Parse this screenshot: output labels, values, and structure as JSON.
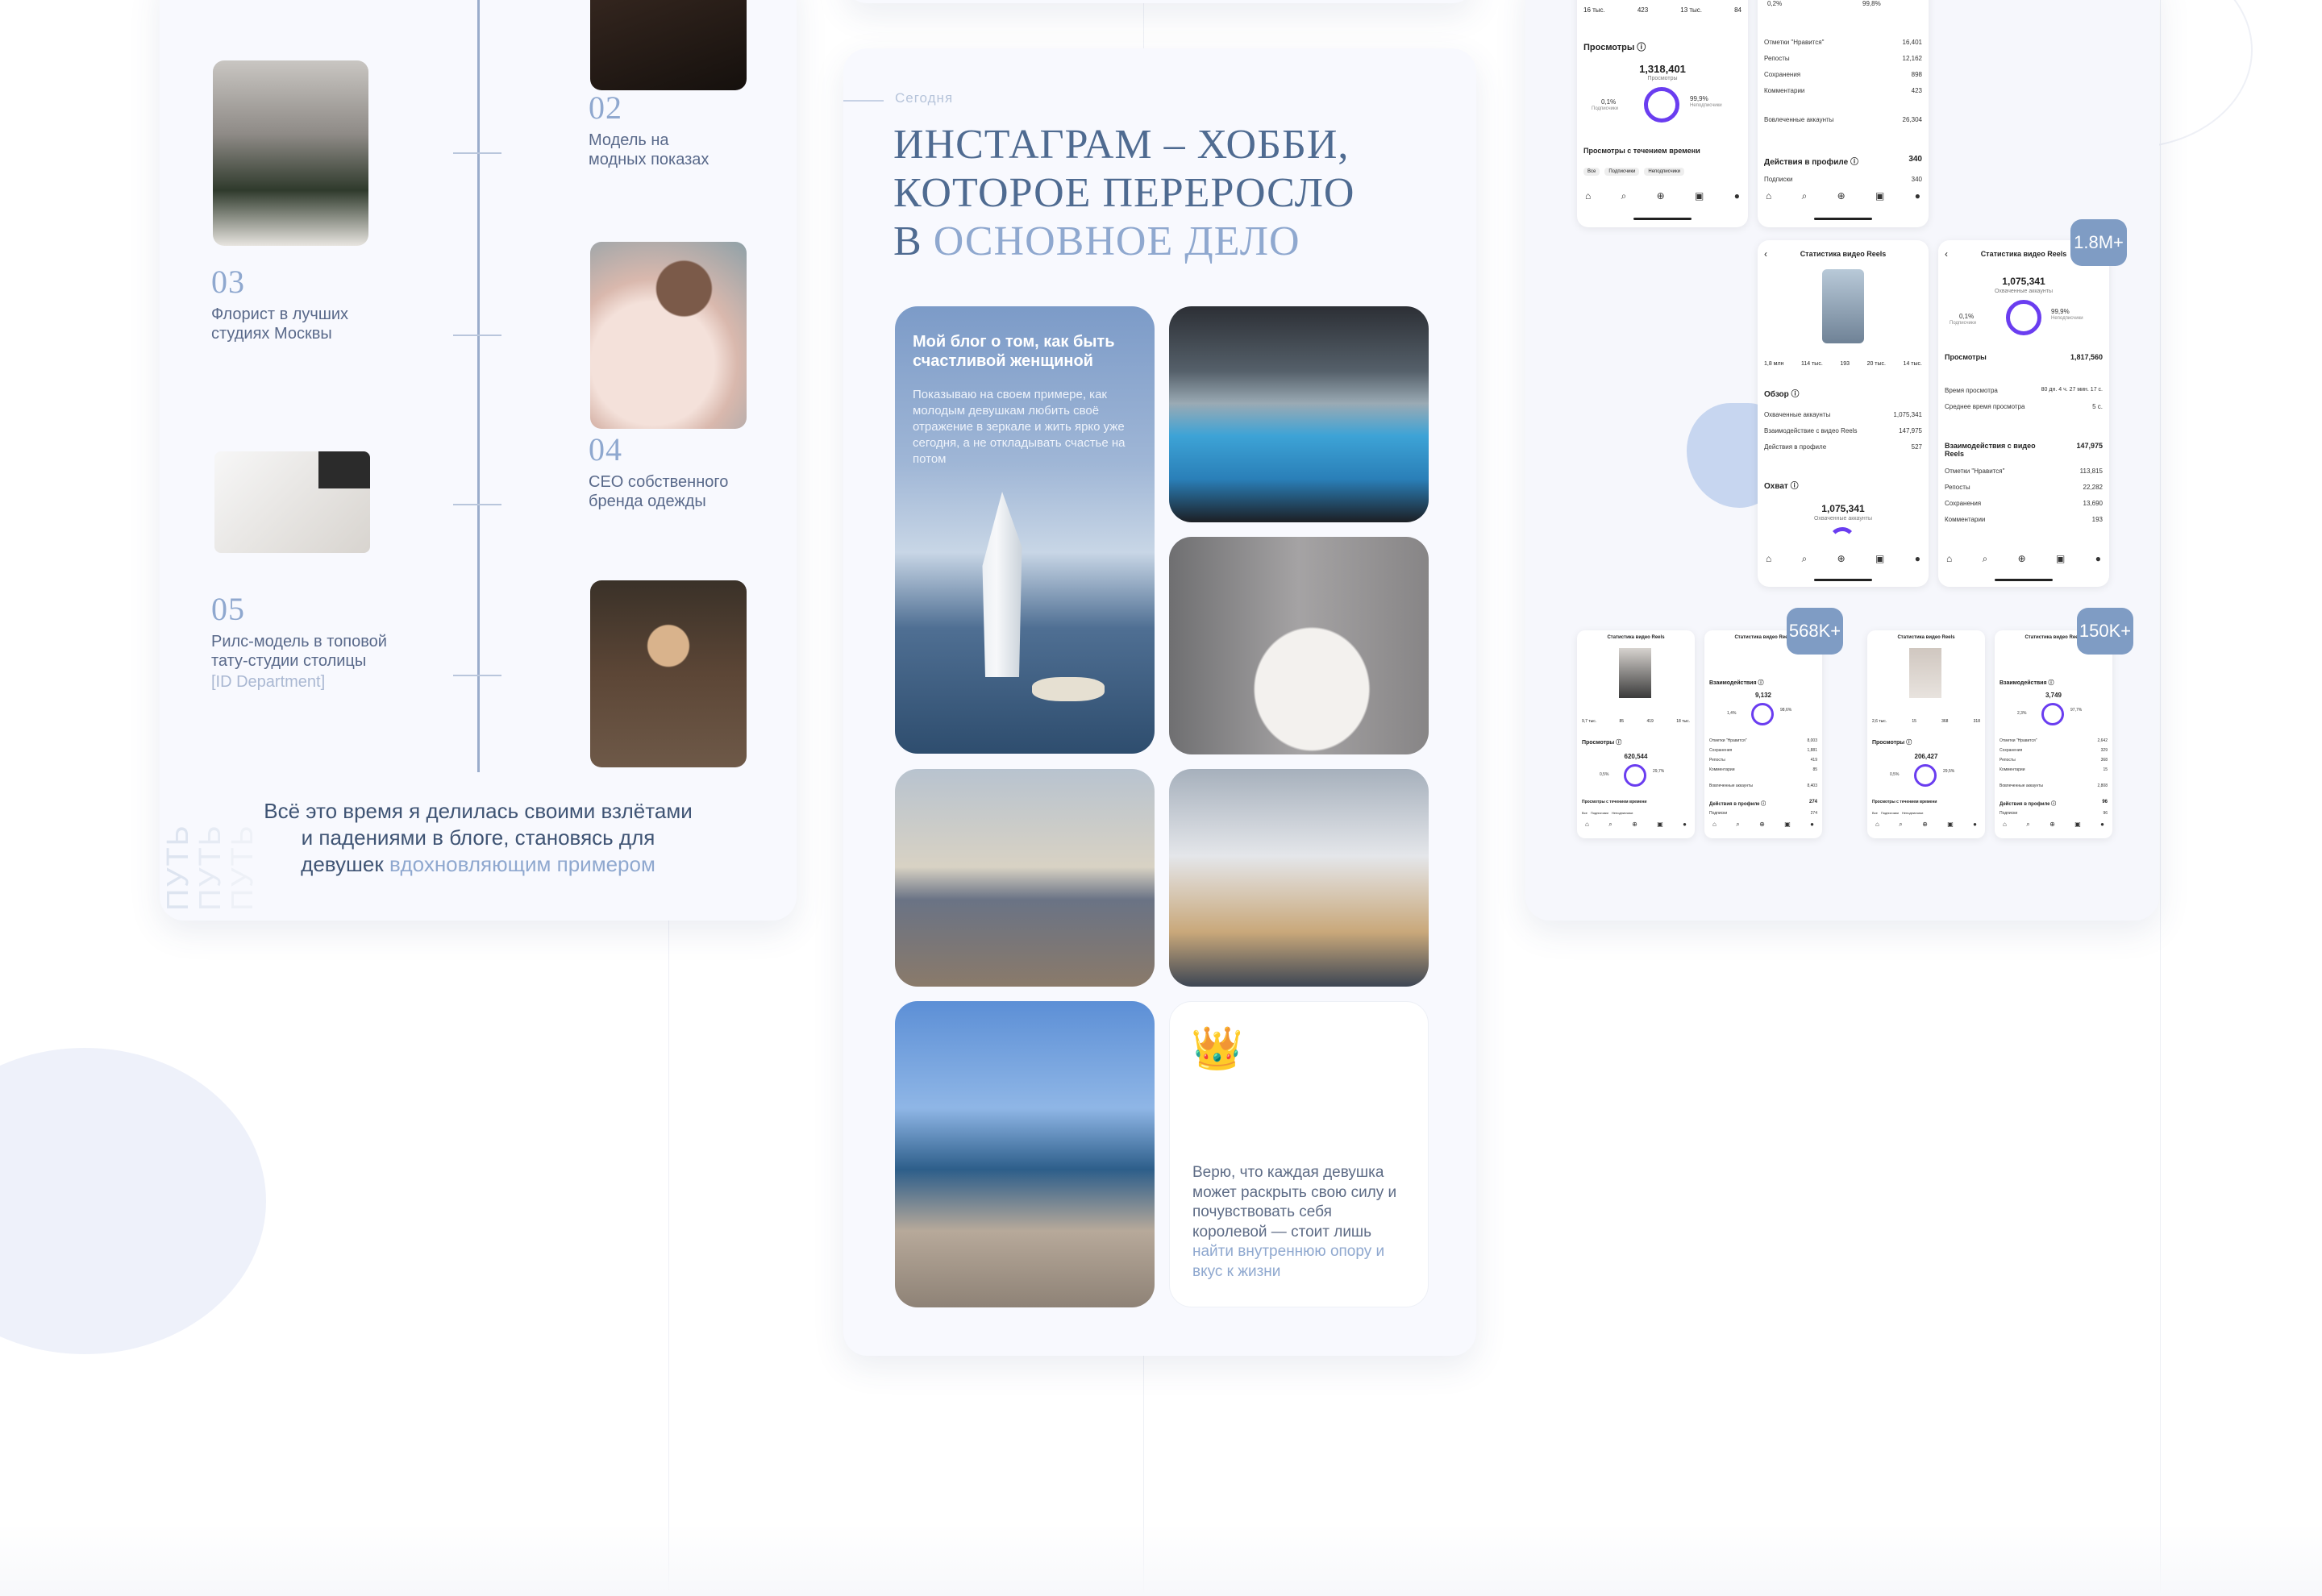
{
  "colors": {
    "accent": "#8fa8cf",
    "title": "#4f6b91",
    "ring": "#6a3df0",
    "badge": "#7f9cc4"
  },
  "timeline": {
    "items": [
      {
        "num": "02",
        "caption": "Модель на\nмодных  показах"
      },
      {
        "num": "03",
        "caption": "Флорист в лучших\nстудиях Москвы"
      },
      {
        "num": "04",
        "caption": "CEO собственного\nбренда одежды"
      },
      {
        "num": "05",
        "caption": "Рилс-модель в топовой\nтату-студии столицы",
        "note": "[ID Department]"
      }
    ],
    "summary": {
      "line1": "Всё это время я делилась своими взлётами",
      "line2": "и падениями в блоге, становясь для",
      "line3": "девушек ",
      "highlight": "вдохновляющим примером"
    },
    "vertical_word": "ПУТЬ"
  },
  "mid": {
    "label": "Сегодня",
    "title_line1": "ИНСТАГРАМ – ХОББИ,",
    "title_line2": "КОТОРОЕ ПЕРЕРОСЛО",
    "title_line3a": "В ",
    "title_line3b": "ОСНОВНОЕ ДЕЛО",
    "blog_title": "Мой блог о том, как быть счастливой женщиной",
    "blog_text": "Показываю на своем примере, как молодым девушкам любить своё отражение в зеркале и жить ярко уже сегодня, а не откладывать счастье на потом",
    "crown": "👑",
    "belief": "Верю, что каждая девушка может раскрыть свою силу и почувствовать себя королевой — стоит лишь ",
    "belief_highlight": "найти внутреннюю опору и вкус к жизни"
  },
  "stats": {
    "top_left": {
      "row": [
        "16 тыс.",
        "423",
        "13 тыс.",
        "84"
      ],
      "views_label": "Просмотры ⓘ",
      "views": "1,318,401",
      "views_sub": "Просмотры",
      "left_pct": "0,1%",
      "left_lbl": "Подписчики",
      "right_pct": "99,9%",
      "right_lbl": "Неподписчики",
      "time_label": "Просмотры с течением времени",
      "chips": [
        "Все",
        "Подписчики",
        "Неподписчики"
      ]
    },
    "top_right": {
      "pct1": "0,2%",
      "pct2": "99,8%",
      "rows": [
        [
          "Отметки \"Нравится\"",
          "16,401"
        ],
        [
          "Репосты",
          "12,162"
        ],
        [
          "Сохранения",
          "898"
        ],
        [
          "Комментарии",
          "423"
        ],
        [
          "Вовлеченные аккаунты",
          "26,304"
        ]
      ],
      "actions_label": "Действия в профиле ⓘ",
      "actions_val": "340",
      "subs_label": "Подписки",
      "subs_val": "340"
    },
    "reels_a": {
      "title": "Статистика видео Reels",
      "row": [
        "1,8 млн",
        "114 тыс.",
        "193",
        "20 тыс.",
        "14 тыс."
      ],
      "overview": "Обзор ⓘ",
      "rows": [
        [
          "Охваченные аккаунты",
          "1,075,341"
        ],
        [
          "Взаимодействие с видео Reels",
          "147,975"
        ],
        [
          "Действия в профиле",
          "527"
        ]
      ],
      "reach_label": "Охват ⓘ",
      "reach": "1,075,341",
      "reach_sub": "Охваченные аккаунты"
    },
    "reels_b": {
      "title": "Статистика видео Reels",
      "reach": "1,075,341",
      "reach_sub": "Охваченные аккаунты",
      "left_pct": "0,1%",
      "left_lbl": "Подписчики",
      "right_pct": "99,9%",
      "right_lbl": "Неподписчики",
      "views_label": "Просмотры",
      "views": "1,817,560",
      "rows1": [
        [
          "Время просмотра",
          "80 дн. 4 ч. 27 мин. 17 с."
        ],
        [
          "Среднее время просмотра",
          "5 с."
        ]
      ],
      "inter_label": "Взаимодействия с видео Reels",
      "inter_val": "147,975",
      "rows2": [
        [
          "Отметки \"Нравится\"",
          "113,815"
        ],
        [
          "Репосты",
          "22,282"
        ],
        [
          "Сохранения",
          "13,690"
        ],
        [
          "Комментарии",
          "193"
        ]
      ]
    },
    "badges": [
      "1.8M+",
      "568K+",
      "150K+"
    ],
    "small_a": {
      "title": "Статистика видео Reels",
      "row": [
        "9,7 тыс.",
        "85",
        "419",
        "18 тыс."
      ],
      "views_label": "Просмотры ⓘ",
      "views": "620,544",
      "l": "0,5%",
      "r": "29,7%",
      "time_label": "Просмотры с течением времени",
      "chips": [
        "Все",
        "Подписчики",
        "Неподписчики"
      ]
    },
    "small_b": {
      "title": "Статистика видео Reels",
      "inter_label": "Взаимодействия ⓘ",
      "inter": "9,132",
      "l": "1,4%",
      "r": "98,6%",
      "rows": [
        [
          "Отметки \"Нравится\"",
          "8,003"
        ],
        [
          "Сохранения",
          "1,881"
        ],
        [
          "Репосты",
          "419"
        ],
        [
          "Комментарии",
          "85"
        ],
        [
          "Вовлеченные аккаунты",
          "8,403"
        ]
      ],
      "actions_label": "Действия в профиле ⓘ",
      "actions_val": "274",
      "subs_label": "Подписки",
      "subs_val": "274"
    },
    "small_c": {
      "title": "Статистика видео Reels",
      "row": [
        "2,6 тыс.",
        "15",
        "368",
        "318"
      ],
      "views_label": "Просмотры ⓘ",
      "views": "206,427",
      "l": "0,5%",
      "r": "29,5%",
      "time_label": "Просмотры с течением времени",
      "chips": [
        "Все",
        "Подписчики",
        "Неподписчики"
      ]
    },
    "small_d": {
      "title": "Статистика видео Reels",
      "inter_label": "Взаимодействия ⓘ",
      "inter": "3,749",
      "l": "2,3%",
      "r": "97,7%",
      "rows": [
        [
          "Отметки \"Нравится\"",
          "2,642"
        ],
        [
          "Сохранения",
          "329"
        ],
        [
          "Репосты",
          "368"
        ],
        [
          "Комментарии",
          "15"
        ],
        [
          "Вовлеченные аккаунты",
          "2,808"
        ]
      ],
      "actions_label": "Действия в профиле ⓘ",
      "actions_val": "96",
      "subs_label": "Подписки",
      "subs_val": "96"
    }
  }
}
